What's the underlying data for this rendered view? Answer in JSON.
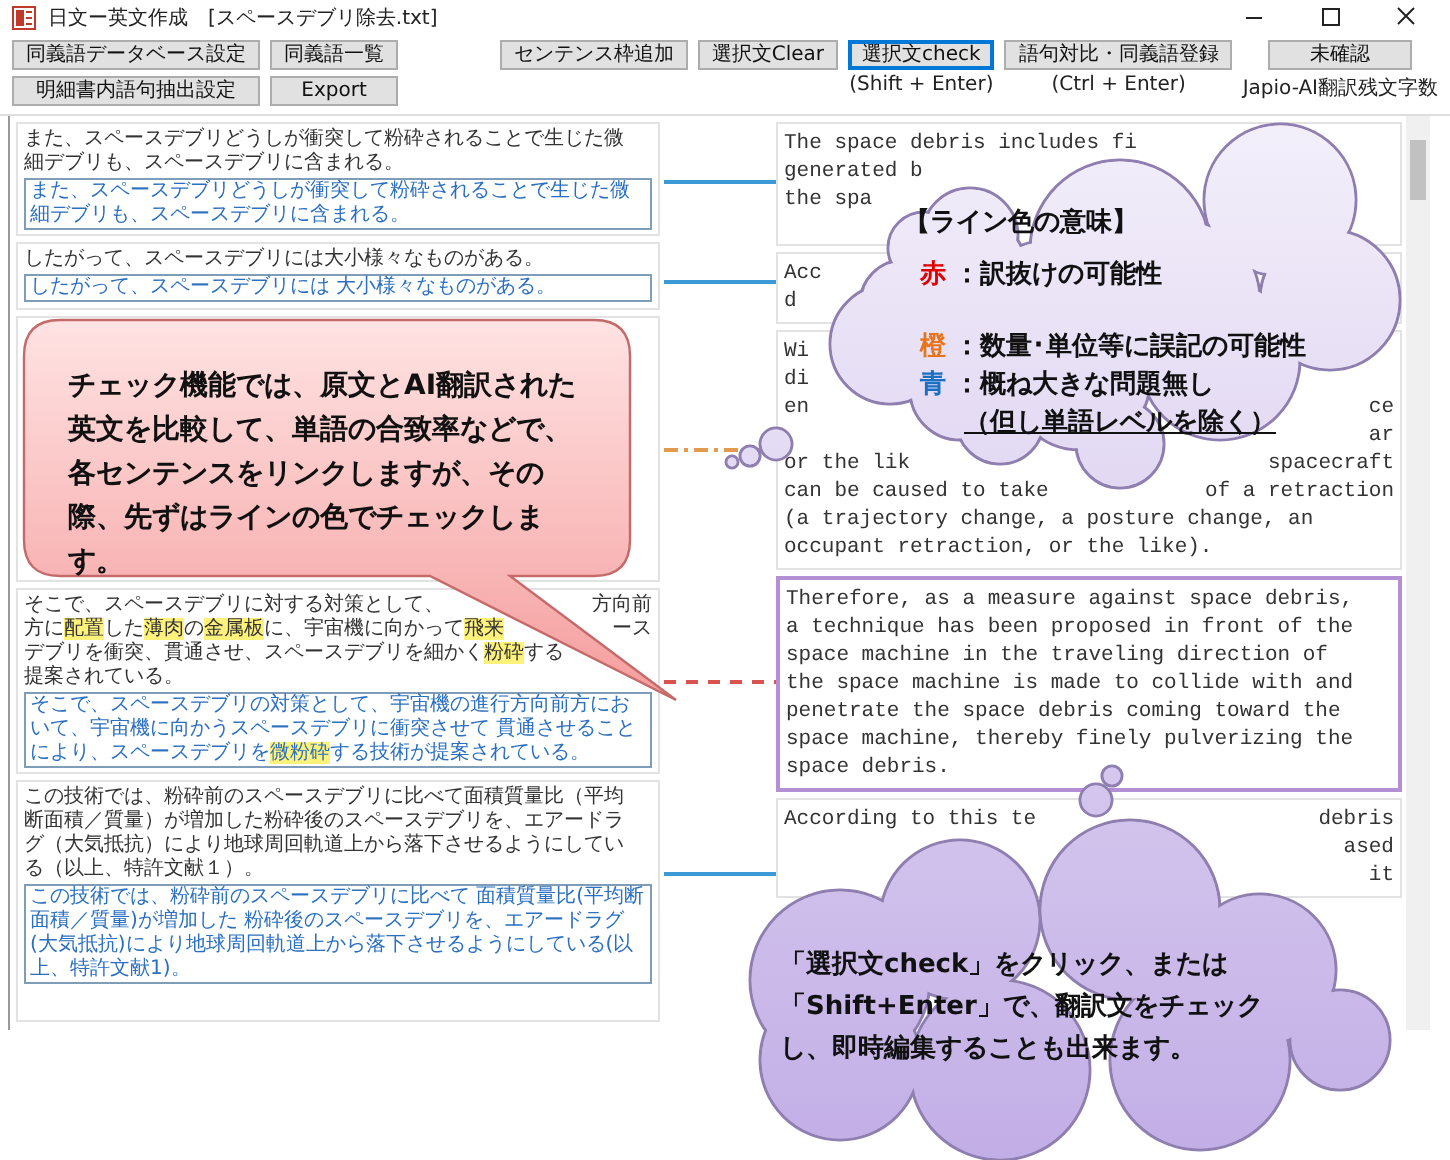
{
  "window": {
    "title": "日文ー英文作成",
    "file": "[スペースデブリ除去.txt]"
  },
  "toolbar": {
    "left_buttons": [
      {
        "label": "同義語データベース設定",
        "focused": false
      },
      {
        "label": "同義語一覧",
        "focused": false
      },
      {
        "label": "明細書内語句抽出設定",
        "focused": false
      },
      {
        "label": "Export",
        "focused": false
      }
    ],
    "right_buttons": [
      {
        "label": "センテンス枠追加",
        "focused": false
      },
      {
        "label": "選択文Clear",
        "focused": false
      },
      {
        "label": "選択文check",
        "focused": true,
        "hint": "(Shift + Enter)"
      },
      {
        "label": "語句対比・同義語登録",
        "focused": false,
        "hint": "(Ctrl + Enter)"
      },
      {
        "label": "未確認",
        "focused": false,
        "hint": "Japio-AI翻訳残文字数"
      }
    ]
  },
  "sentences": [
    {
      "source": [
        "また、スペースデブリどうしが衝突して粉砕されることで生じた微",
        "細デブリも、スペースデブリに含まれる。"
      ],
      "translation": [
        {
          "text": "また、スペースデブリどうしが衝突して粉砕されることで生じた微細デブリも、スペースデブリに含まれる。",
          "highlight": false
        }
      ],
      "target": [
        {
          "text": "The space debris includes fi"
        },
        {
          "text": "generated b"
        },
        {
          "text": "the spa"
        }
      ],
      "kind": "ok",
      "selected": false
    },
    {
      "source": [
        "したがって、スペースデブリには大小様々なものがある。"
      ],
      "translation": [
        {
          "text": "したがって、スペースデブリには 大小様々なものがある。",
          "highlight": false
        }
      ],
      "target": [
        {
          "text": "Acc"
        },
        {
          "text": "d"
        }
      ],
      "kind": "ok",
      "selected": false
    },
    {
      "target": [
        {
          "text": "Wi"
        },
        {
          "text": "di"
        },
        {
          "text": "en",
          "tail": "ce"
        },
        {
          "tail": "ar"
        },
        {
          "text": "or the lik",
          "tail": "spacecraft"
        },
        {
          "text": "can be caused to take",
          "tail": "of a retraction"
        },
        {
          "text": "(a trajectory change, a posture change, an"
        },
        {
          "text": "occupant retraction, or the like)."
        }
      ],
      "kind": "unit",
      "selected": false
    },
    {
      "source": [
        {
          "runs": [
            {
              "text": "そこで、スペースデブリに対する対策として、",
              "highlight": false
            }
          ],
          "tail": "方向前"
        },
        {
          "runs": [
            {
              "text": "方に",
              "highlight": false
            },
            {
              "text": "配置",
              "highlight": true
            },
            {
              "text": "した",
              "highlight": false
            },
            {
              "text": "薄肉",
              "highlight": true
            },
            {
              "text": "の",
              "highlight": false
            },
            {
              "text": "金属板",
              "highlight": true
            },
            {
              "text": "に、宇宙機に向かって",
              "highlight": false
            },
            {
              "text": "飛来",
              "highlight": true
            }
          ],
          "tail": "ース"
        },
        {
          "runs": [
            {
              "text": "デブリを衝突、貫通させ、スペースデブリを細かく",
              "highlight": false
            },
            {
              "text": "粉砕",
              "highlight": true
            },
            {
              "text": "する",
              "highlight": false
            }
          ]
        },
        {
          "runs": [
            {
              "text": "提案されている。",
              "highlight": false
            }
          ]
        }
      ],
      "translation": [
        {
          "text": "そこで、スペースデブリの対策として、宇宙機の進行方向前方において、宇宙機に向かうスペースデブリに衝突させて 貫通させることにより、スペースデブリを",
          "highlight": false
        },
        {
          "text": "微粉砕",
          "highlight": true
        },
        {
          "text": "する技術が提案されている。",
          "highlight": false
        }
      ],
      "target": [
        {
          "text": "Therefore, as a measure against space debris,"
        },
        {
          "text": "a technique has been proposed in front of the"
        },
        {
          "text": "space machine in the traveling direction of"
        },
        {
          "text": "the space machine is made to collide with and"
        },
        {
          "text": "penetrate the space debris coming toward the"
        },
        {
          "text": "space machine, thereby finely pulverizing the"
        },
        {
          "text": "space debris."
        }
      ],
      "kind": "omission",
      "selected": true
    },
    {
      "source": [
        "この技術では、粉砕前のスペースデブリに比べて面積質量比（平均",
        "断面積／質量）が増加した粉砕後のスペースデブリを、エアードラ",
        "グ（大気抵抗）により地球周回軌道上から落下させるようにしてい",
        "る（以上、特許文献１）。"
      ],
      "translation": [
        {
          "text": "この技術では、粉砕前のスペースデブリに比べて 面積質量比(平均断面積／質量)が増加した 粉砕後のスペースデブリを、エアードラグ(大気抵抗)により地球周回軌道上から落下させるようにしている(以上、特許文献1)。",
          "highlight": false
        }
      ],
      "target": [
        {
          "text": "According to this te",
          "tail": "debris"
        },
        {
          "tail": "ased"
        },
        {
          "tail": "it"
        }
      ],
      "kind": "ok",
      "selected": false
    }
  ],
  "callout": {
    "text": "チェック機能では、原文とAI翻訳された英文を比較して、単語の合致率などで、各センテンスをリンクしますが、その際、先ずはラインの色でチェックします。"
  },
  "legend": {
    "title": "【ライン色の意味】",
    "items": [
      {
        "mark": "赤",
        "color": "#e00000",
        "text": "：訳抜けの可能性"
      },
      {
        "mark": "橙",
        "color": "#e8731a",
        "text": "：数量･単位等に誤記の可能性"
      },
      {
        "mark": "青",
        "color": "#1b6fc2",
        "text": "：概ね大きな問題無し"
      }
    ],
    "note": "（但し単語レベルを除く）"
  },
  "tip": {
    "text": "「選択文check」をクリック、または「Shift+Enter」で、翻訳文をチェックし、即時編集することも出来ます。"
  }
}
